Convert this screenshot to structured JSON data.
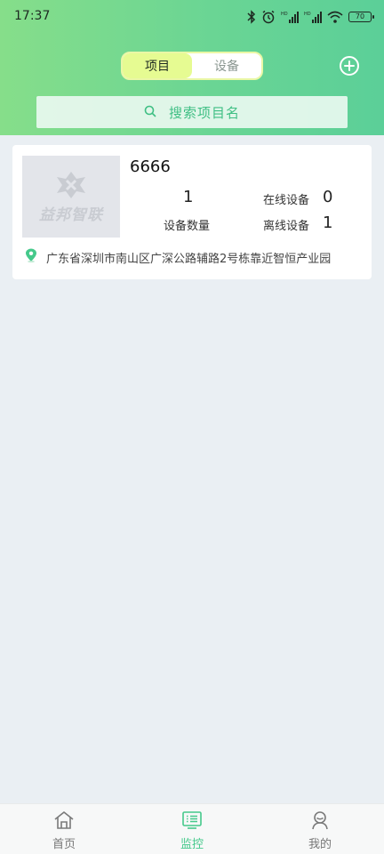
{
  "status_bar": {
    "time": "17:37",
    "battery": "70"
  },
  "header": {
    "tabs": [
      {
        "label": "项目",
        "active": true
      },
      {
        "label": "设备",
        "active": false
      }
    ],
    "add_icon": "plus-circle-icon",
    "search": {
      "placeholder": "搜索项目名",
      "icon": "search-icon"
    }
  },
  "projects": [
    {
      "thumbnail_label": "益邦智联",
      "name": "6666",
      "device_count": "1",
      "device_count_label": "设备数量",
      "online_label": "在线设备",
      "online_count": "0",
      "offline_label": "离线设备",
      "offline_count": "1",
      "address": "广东省深圳市南山区广深公路辅路2号栋靠近智恒产业园",
      "address_icon": "location-pin-icon"
    }
  ],
  "bottom_nav": [
    {
      "label": "首页",
      "icon": "home-icon",
      "active": false
    },
    {
      "label": "监控",
      "icon": "monitor-list-icon",
      "active": true
    },
    {
      "label": "我的",
      "icon": "user-icon",
      "active": false
    }
  ],
  "colors": {
    "header_gradient_start": "#86de8a",
    "header_gradient_end": "#5bcf98",
    "accent": "#45c98b",
    "active_tab_bg": "#e6fb92",
    "page_bg": "#eaeff3"
  }
}
